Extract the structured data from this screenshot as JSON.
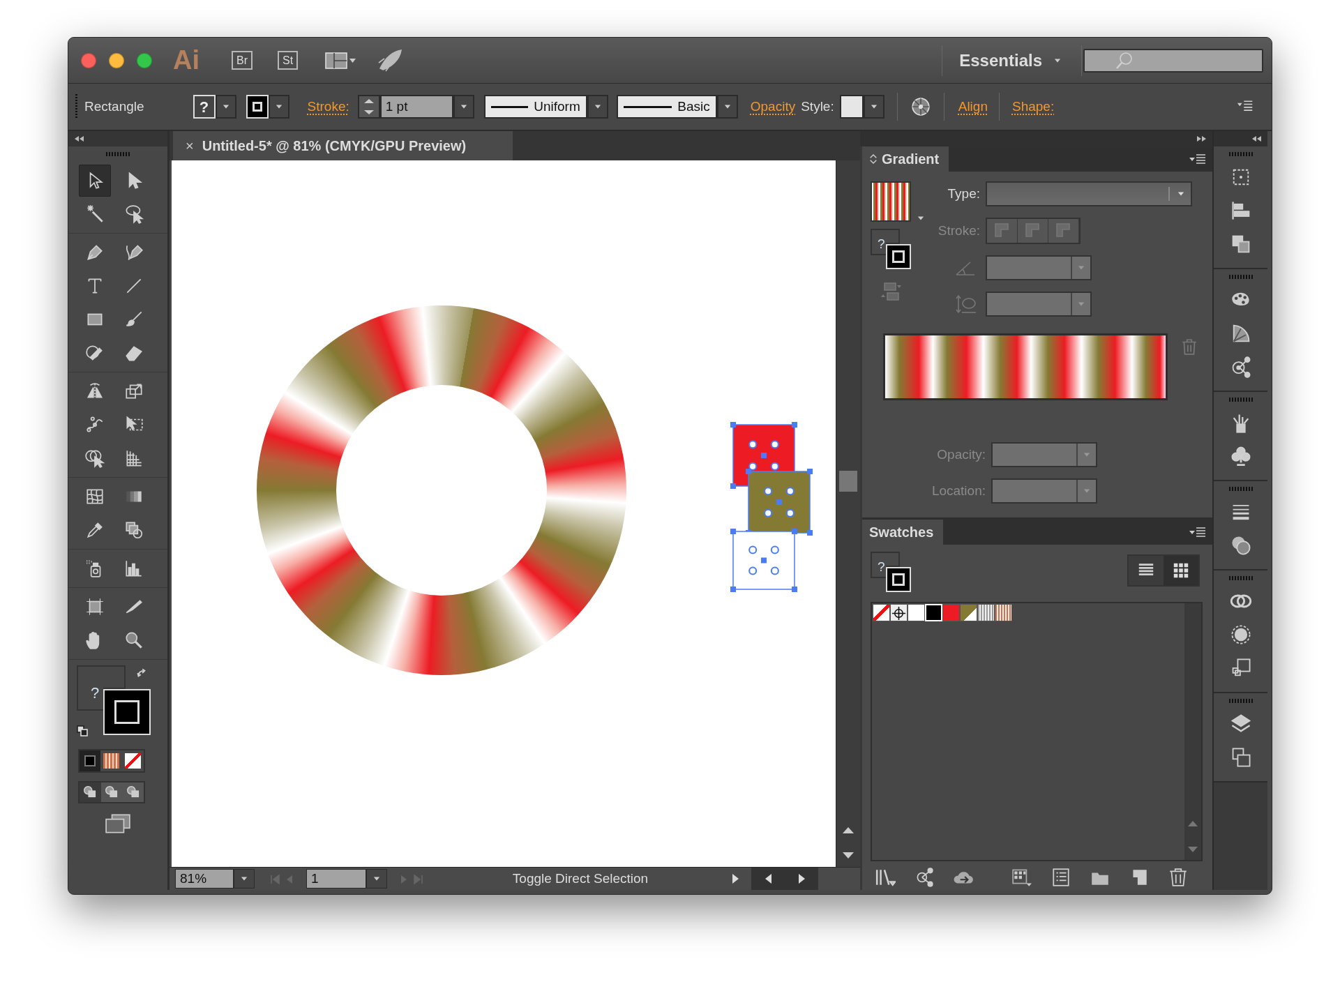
{
  "title_bar": {
    "app_logo": "Ai",
    "app_buttons": [
      "Br",
      "St"
    ],
    "workspace": "Essentials"
  },
  "control_bar": {
    "tool_name": "Rectangle",
    "fill_mark": "?",
    "stroke_link": "Stroke:",
    "stroke_weight": "1 pt",
    "variable_width": "Uniform",
    "brush": "Basic",
    "opacity_link": "Opacity",
    "style_label": "Style:",
    "align_link": "Align",
    "shape_link": "Shape:"
  },
  "document_tab": {
    "close": "×",
    "title": "Untitled-5* @ 81% (CMYK/GPU Preview)"
  },
  "tool_groups": [
    [
      {
        "kind": "selection",
        "selected": true
      },
      {
        "kind": "direct-selection",
        "selected": false
      },
      {
        "kind": "magic-wand",
        "selected": false
      },
      {
        "kind": "lasso",
        "selected": false
      }
    ],
    [
      {
        "kind": "pen",
        "selected": false
      },
      {
        "kind": "curvature",
        "selected": false
      },
      {
        "kind": "type",
        "selected": false
      },
      {
        "kind": "line",
        "selected": false
      },
      {
        "kind": "rectangle",
        "selected": false
      },
      {
        "kind": "paintbrush",
        "selected": false
      },
      {
        "kind": "shaper",
        "selected": false
      },
      {
        "kind": "eraser",
        "selected": false
      }
    ],
    [
      {
        "kind": "reflect",
        "selected": false
      },
      {
        "kind": "scale",
        "selected": false
      },
      {
        "kind": "warp",
        "selected": false
      },
      {
        "kind": "free-transform",
        "selected": false
      },
      {
        "kind": "shape-builder",
        "selected": false
      },
      {
        "kind": "perspective-grid",
        "selected": false
      }
    ],
    [
      {
        "kind": "mesh",
        "selected": false
      },
      {
        "kind": "gradient",
        "selected": false
      },
      {
        "kind": "eyedropper",
        "selected": false
      },
      {
        "kind": "blend",
        "selected": false
      }
    ],
    [
      {
        "kind": "symbol-sprayer",
        "selected": false
      },
      {
        "kind": "column-graph",
        "selected": false
      }
    ],
    [
      {
        "kind": "artboard",
        "selected": false
      },
      {
        "kind": "slice",
        "selected": false
      },
      {
        "kind": "hand",
        "selected": false
      },
      {
        "kind": "zoom",
        "selected": false
      }
    ]
  ],
  "toolbox": {
    "fill_mark": "?"
  },
  "gradient_panel": {
    "title": "Gradient",
    "fill_mark": "?",
    "fields": [
      {
        "label": "Type:",
        "disabled": false
      },
      {
        "label": "Stroke:",
        "disabled": true
      },
      {
        "label": "Opacity:",
        "disabled": true
      },
      {
        "label": "Location:",
        "disabled": true
      }
    ]
  },
  "swatches_panel": {
    "title": "Swatches",
    "fill_mark": "?",
    "views": [
      {
        "kind": "list",
        "selected": false
      },
      {
        "kind": "grid",
        "selected": true
      }
    ],
    "swatches": [
      {
        "kind": "none"
      },
      {
        "kind": "registration"
      },
      {
        "kind": "color",
        "color": "#ffffff"
      },
      {
        "kind": "color",
        "color": "#000000"
      },
      {
        "kind": "color",
        "color": "#ed1c24"
      },
      {
        "kind": "global",
        "color": "#857a34"
      },
      {
        "kind": "gradient",
        "color": "#9a9a9a"
      },
      {
        "kind": "gradient",
        "color": "#d2704a"
      }
    ]
  },
  "status_bar": {
    "zoom": "81%",
    "artboard": "1",
    "message": "Toggle Direct Selection"
  }
}
